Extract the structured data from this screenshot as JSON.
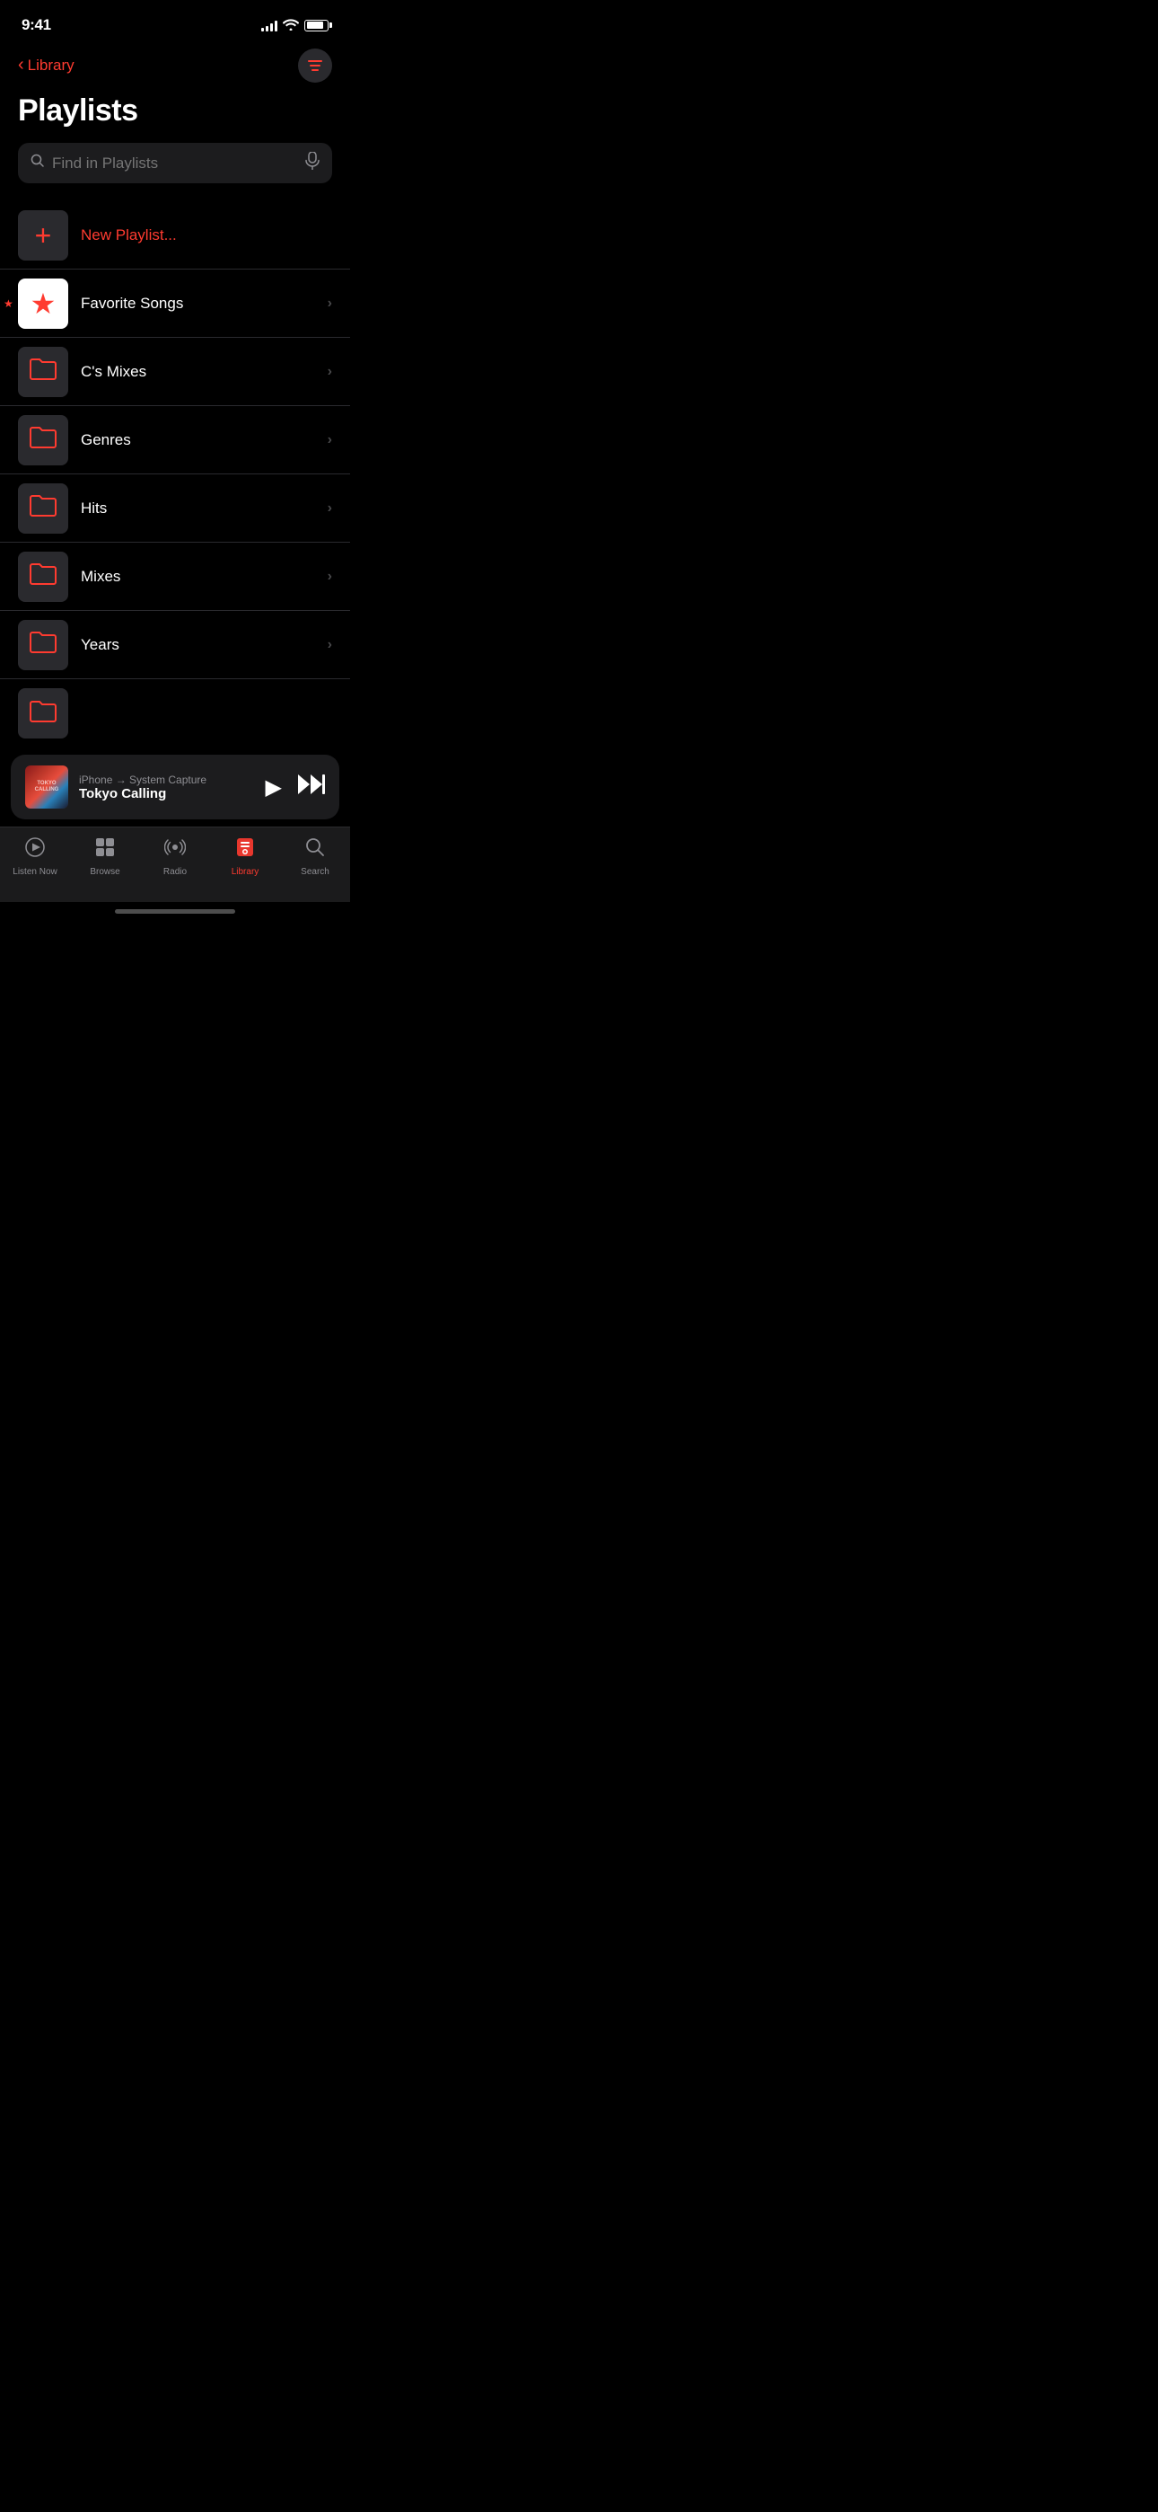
{
  "status": {
    "time": "9:41",
    "signal_bars": [
      4,
      6,
      8,
      10,
      12
    ],
    "battery_level": 85
  },
  "nav": {
    "back_label": "Library",
    "filter_icon": "filter-icon"
  },
  "page": {
    "title": "Playlists"
  },
  "search": {
    "placeholder": "Find in Playlists",
    "search_icon": "search-icon",
    "mic_icon": "mic-icon"
  },
  "playlists": [
    {
      "id": "new-playlist",
      "label": "New Playlist...",
      "icon_type": "plus",
      "thumb_bg": "dark",
      "is_red_label": true,
      "has_chevron": false
    },
    {
      "id": "favorite-songs",
      "label": "Favorite Songs",
      "icon_type": "star",
      "thumb_bg": "white",
      "is_red_label": false,
      "has_chevron": true
    },
    {
      "id": "cs-mixes",
      "label": "C's Mixes",
      "icon_type": "folder",
      "thumb_bg": "dark",
      "is_red_label": false,
      "has_chevron": true
    },
    {
      "id": "genres",
      "label": "Genres",
      "icon_type": "folder",
      "thumb_bg": "dark",
      "is_red_label": false,
      "has_chevron": true
    },
    {
      "id": "hits",
      "label": "Hits",
      "icon_type": "folder",
      "thumb_bg": "dark",
      "is_red_label": false,
      "has_chevron": true
    },
    {
      "id": "mixes",
      "label": "Mixes",
      "icon_type": "folder",
      "thumb_bg": "dark",
      "is_red_label": false,
      "has_chevron": true
    },
    {
      "id": "years",
      "label": "Years",
      "icon_type": "folder",
      "thumb_bg": "dark",
      "is_red_label": false,
      "has_chevron": true
    }
  ],
  "now_playing": {
    "source": "iPhone → System Capture",
    "title": "Tokyo Calling",
    "play_icon": "▶",
    "forward_icon": "⏭"
  },
  "tabs": [
    {
      "id": "listen-now",
      "label": "Listen Now",
      "icon": "▶",
      "active": false
    },
    {
      "id": "browse",
      "label": "Browse",
      "icon": "⊞",
      "active": false
    },
    {
      "id": "radio",
      "label": "Radio",
      "icon": "((·))",
      "active": false
    },
    {
      "id": "library",
      "label": "Library",
      "icon": "♪",
      "active": true
    },
    {
      "id": "search",
      "label": "Search",
      "icon": "⌕",
      "active": false
    }
  ]
}
